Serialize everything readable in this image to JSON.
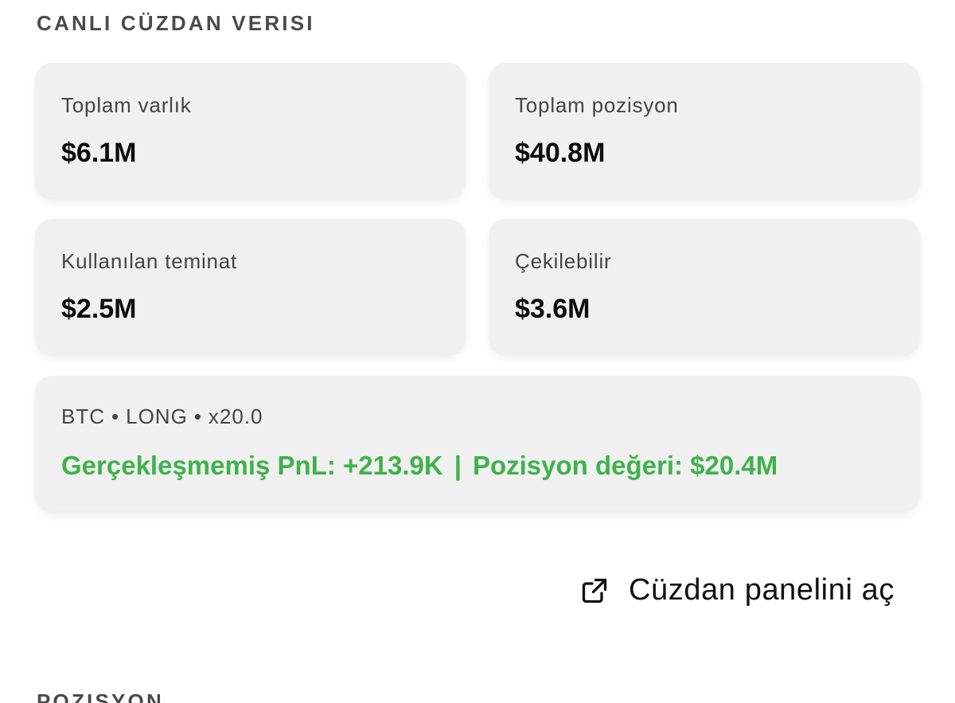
{
  "header": {
    "title": "CANLI CÜZDAN VERISI"
  },
  "stats": [
    {
      "label": "Toplam varlık",
      "value": "$6.1M"
    },
    {
      "label": "Toplam pozisyon",
      "value": "$40.8M"
    },
    {
      "label": "Kullanılan teminat",
      "value": "$2.5M"
    },
    {
      "label": "Çekilebilir",
      "value": "$3.6M"
    }
  ],
  "position": {
    "asset": "BTC",
    "side": "LONG",
    "leverage": "x20.0",
    "separator": "•",
    "pnl_text": "Gerçekleşmemiş PnL: +213.9K",
    "divider": "|",
    "value_text": "Pozisyon değeri: $20.4M",
    "pnl_color": "#3fb24c"
  },
  "actions": {
    "open_wallet_label": "Cüzdan panelini aç",
    "open_wallet_icon": "external-link-icon"
  },
  "next_section": {
    "title": "POZISYON"
  }
}
